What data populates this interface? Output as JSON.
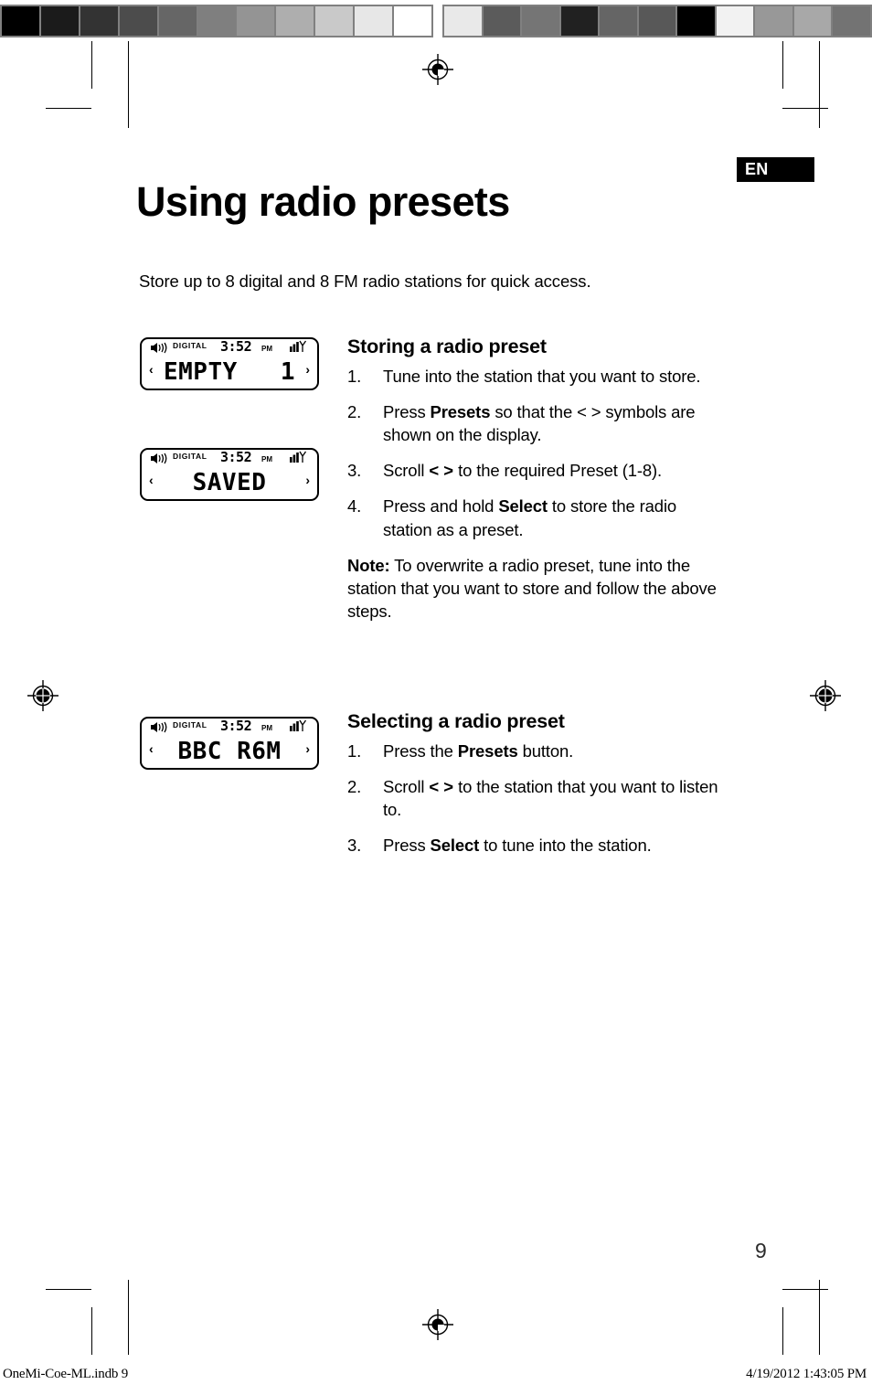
{
  "document": {
    "title": "Using radio presets",
    "language_badge": "EN",
    "intro": "Store up to 8 digital and 8 FM radio stations for quick access.",
    "page_number": "9"
  },
  "footer": {
    "file": "OneMi-Coe-ML.indb   9",
    "timestamp": "4/19/2012   1:43:05 PM"
  },
  "calibration_bar": {
    "left_swatches": [
      "#000000",
      "#1b1b1b",
      "#333333",
      "#4c4c4c",
      "#666666",
      "#7f7f7f",
      "#949494",
      "#aeaeae",
      "#c9c9c9",
      "#e7e7e7",
      "#ffffff"
    ],
    "right_swatches": [
      "#e9e9e9",
      "#5b5b5b",
      "#757575",
      "#212121",
      "#656565",
      "#585858",
      "#000000",
      "#f2f2f2",
      "#989898",
      "#a8a8a8",
      "#737373"
    ]
  },
  "lcd_screens": [
    {
      "id": "lcd-empty-1",
      "speaker_icon": "speaker-icon",
      "mode_label": "DIGITAL",
      "clock": "3:52",
      "meridiem": "PM",
      "signal_icon": "signal-antenna-icon",
      "arrow_left": "‹",
      "arrow_right": "›",
      "display_text": "EMPTY",
      "display_text_right": "1"
    },
    {
      "id": "lcd-saved",
      "speaker_icon": "speaker-icon",
      "mode_label": "DIGITAL",
      "clock": "3:52",
      "meridiem": "PM",
      "signal_icon": "signal-antenna-icon",
      "arrow_left": "‹",
      "arrow_right": "›",
      "display_text": "SAVED",
      "display_text_right": ""
    },
    {
      "id": "lcd-bbc-r6m",
      "speaker_icon": "speaker-icon",
      "mode_label": "DIGITAL",
      "clock": "3:52",
      "meridiem": "PM",
      "signal_icon": "signal-antenna-icon",
      "arrow_left": "‹",
      "arrow_right": "›",
      "display_text": "BBC R6M",
      "display_text_right": ""
    }
  ],
  "sections": [
    {
      "heading": "Storing a radio preset",
      "steps": [
        {
          "num": "1.",
          "text_1": "Tune into the station that you want to store.",
          "bold_1": "",
          "text_2": "",
          "bold_2": "",
          "text_3": ""
        },
        {
          "num": "2.",
          "text_1": "Press ",
          "bold_1": "Presets",
          "text_2": " so that the < > symbols are shown on the display.",
          "bold_2": "",
          "text_3": ""
        },
        {
          "num": "3.",
          "text_1": "Scroll  ",
          "bold_1": "< >",
          "text_2": " to the required Preset (1-8).",
          "bold_2": "",
          "text_3": ""
        },
        {
          "num": "4.",
          "text_1": "Press and hold ",
          "bold_1": "Select",
          "text_2": " to store the radio station as a preset.",
          "bold_2": "",
          "text_3": ""
        }
      ],
      "note": {
        "label": "Note:",
        "text": " To overwrite a radio preset, tune into the station that you want to store and follow the above steps."
      }
    },
    {
      "heading": "Selecting a radio preset",
      "steps": [
        {
          "num": "1.",
          "text_1": "Press the ",
          "bold_1": "Presets",
          "text_2": " button.",
          "bold_2": "",
          "text_3": ""
        },
        {
          "num": "2.",
          "text_1": "Scroll  ",
          "bold_1": "< >",
          "text_2": " to the station that you want to listen to.",
          "bold_2": "",
          "text_3": ""
        },
        {
          "num": "3.",
          "text_1": "Press ",
          "bold_1": "Select",
          "text_2": " to tune into the station.",
          "bold_2": "",
          "text_3": ""
        }
      ],
      "note": null
    }
  ]
}
